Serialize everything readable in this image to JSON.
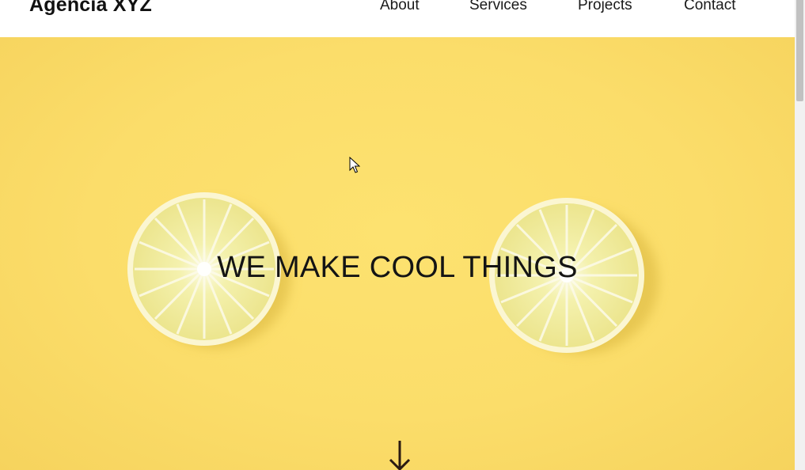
{
  "header": {
    "brand": "Agência XYZ",
    "nav": [
      {
        "label": "About"
      },
      {
        "label": "Services"
      },
      {
        "label": "Projects"
      },
      {
        "label": "Contact"
      }
    ]
  },
  "hero": {
    "title": "WE MAKE COOL THINGS",
    "background_color": "#fbdd6a",
    "scroll_icon": "arrow-down-icon"
  },
  "colors": {
    "header_bg": "#ffffff",
    "text": "#141414",
    "lemon_flesh": "#f3ef9c",
    "lemon_rind": "#fbf7d6"
  }
}
